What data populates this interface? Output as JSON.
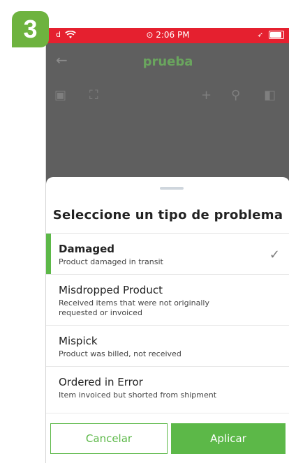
{
  "step_badge": "3",
  "status_bar": {
    "time": "⊙ 2:06 PM"
  },
  "app_bar": {
    "title": "prueba"
  },
  "sheet": {
    "title": "Seleccione un tipo de problema",
    "options": [
      {
        "name": "Damaged",
        "description": "Product damaged in transit",
        "selected": true
      },
      {
        "name": "Misdropped Product",
        "description": "Received items that were not originally requested or invoiced",
        "selected": false
      },
      {
        "name": "Mispick",
        "description": "Product was billed, not received",
        "selected": false
      },
      {
        "name": "Ordered in Error",
        "description": "Item invoiced but shorted from shipment",
        "selected": false
      }
    ]
  },
  "buttons": {
    "cancel": "Cancelar",
    "apply": "Aplicar"
  },
  "colors": {
    "accent_green": "#5cb848",
    "status_red": "#e5202f",
    "overlay_gray": "#5f5f5f",
    "title_green": "#6aa55e"
  }
}
